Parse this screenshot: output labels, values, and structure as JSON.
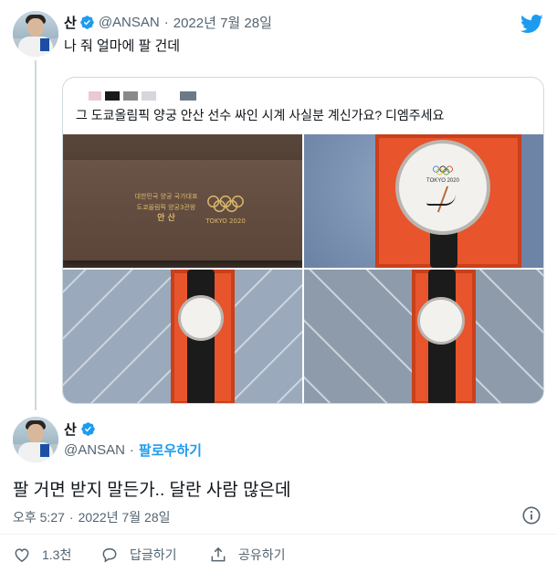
{
  "first_tweet": {
    "display_name": "산",
    "handle": "@ANSAN",
    "separator": "·",
    "date": "2022년 7월 28일",
    "text": "나 줘 얼마에 팔 건데"
  },
  "quoted_tweet": {
    "text": "그 도쿄올림픽 양궁 안산 선수 싸인 시계 사실분 계신가요? 디엠주세요",
    "box_text_line1": "대한민국 양궁 국가대표",
    "box_text_line2": "도쿄올림픽 양궁3관왕",
    "box_text_name": "안 산",
    "box_text_event": "TOKYO 2020",
    "dial_text": "TOKYO 2020"
  },
  "main_tweet": {
    "display_name": "산",
    "handle": "@ANSAN",
    "separator": "·",
    "follow_label": "팔로우하기",
    "text": "팔 거면 받지 말든가.. 달란 사람 많은데",
    "time": "오후 5:27",
    "date": "2022년 7월 28일"
  },
  "actions": {
    "like_count": "1.3천",
    "reply_label": "답글하기",
    "share_label": "공유하기"
  },
  "colors": {
    "accent": "#1d9bf0",
    "secondary_text": "#536471",
    "border": "#cfd9de"
  },
  "icons": [
    "twitter-bird-icon",
    "verified-badge-icon",
    "info-icon",
    "heart-icon",
    "reply-icon",
    "share-icon"
  ]
}
